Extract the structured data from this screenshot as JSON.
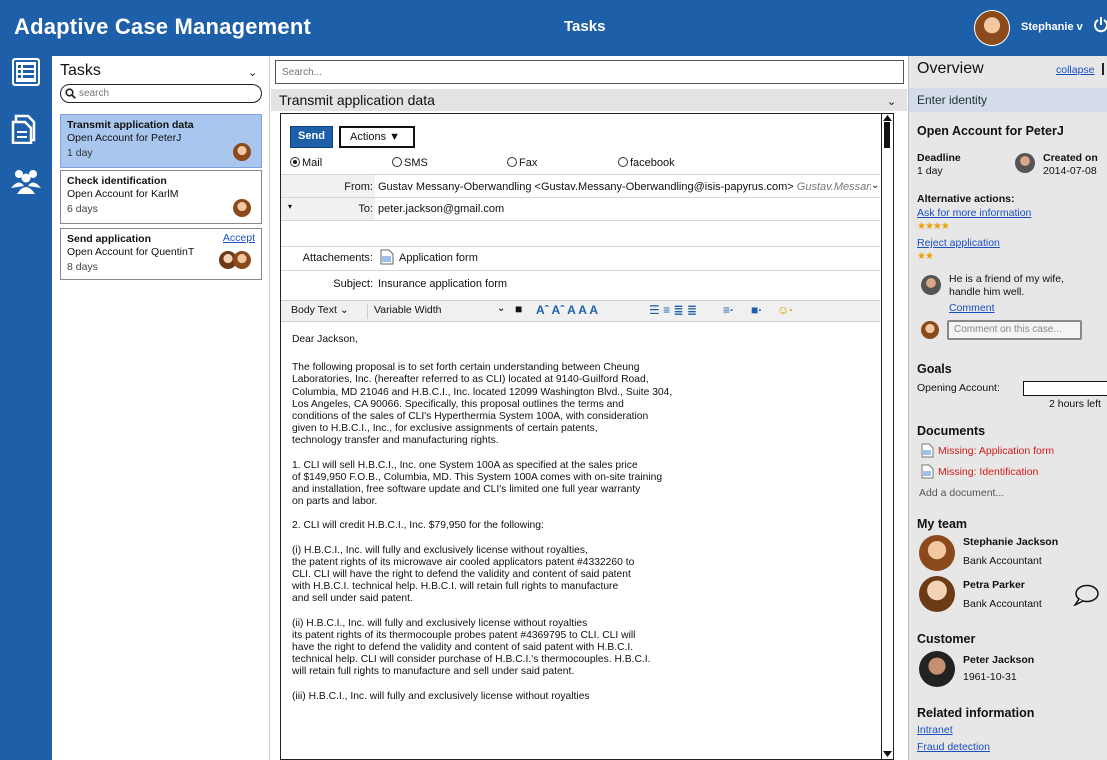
{
  "header": {
    "app_title": "Adaptive Case Management",
    "center_title": "Tasks",
    "user_name": "Stephanie v"
  },
  "rail": {
    "icons": [
      "task-list-icon",
      "documents-icon",
      "team-icon"
    ]
  },
  "tasks": {
    "title": "Tasks",
    "search_placeholder": "search",
    "items": [
      {
        "title": "Transmit application data",
        "subtitle": "Open Account for PeterJ",
        "age": "1 day"
      },
      {
        "title": "Check identification",
        "subtitle": "Open Account for KarlM",
        "age": "6 days"
      },
      {
        "title": "Send application",
        "subtitle": "Open Account for QuentinT",
        "age": "8 days",
        "action": "Accept"
      }
    ]
  },
  "main": {
    "search_placeholder": "Search...",
    "section_title": "Transmit application data",
    "send_label": "Send",
    "actions_label": "Actions",
    "channels": [
      {
        "label": "Mail",
        "selected": true
      },
      {
        "label": "SMS",
        "selected": false
      },
      {
        "label": "Fax",
        "selected": false
      },
      {
        "label": "facebook",
        "selected": false
      }
    ],
    "from_label": "From:",
    "from_value": "Gustav Messany-Oberwandling <Gustav.Messany-Oberwandling@isis-papyrus.com>",
    "from_secondary": "Gustav.Messany-...",
    "to_label": "To:",
    "to_value": "peter.jackson@gmail.com",
    "attachments_label": "Attachements:",
    "attachment": "Application form",
    "subject_label": "Subject:",
    "subject_value": "Insurance application form",
    "toolbar": {
      "style_select": "Body Text",
      "font_select": "Variable Width",
      "format_glyphs": "Aˆ Aˆ A A A",
      "list_glyphs": "☰ ≡ ≣ ≣",
      "align_glyph": "≡·",
      "emoji_glyph": "☺·"
    },
    "body": [
      "Dear Jackson,",
      "The following  proposal is to set forth  certain  understanding  between  Cheung\nLaboratories, Inc. (hereafter referred to as CLI) located at 9140-Guilford Road,\nColumbia, MD 21046 and H.B.C.I., Inc. located 12099 Washington Blvd., Suite 304,\nLos  Angeles,  CA 90066.  Specifically,  this proposal  outlines  the  terms and\nconditions of the sales of CLI's  Hyperthermia  System 100A, with  consideration\ngiven  to H.B.C.I.,  Inc.,  for exclusive  assignments  of  certain  patents,\ntechnology transfer and manufacturing rights.",
      "1. CLI will sell H.B.C.I.,  Inc. one System 100A as specified at the sales price\nof $149,950 F.O.B.,  Columbia,  MD. This System 100A comes with on-site training\nand installation,  free software update and CLI's limited one full year warranty\non parts and labor.",
      "2.      CLI will credit H.B.C.I., Inc. $79,950 for the following:",
      "    (i) H.B.C.I.,  Inc. will fully and exclusively  license without  royalties,\nthe patent  rights of its microwave air cooled  applicators  patent  #4332260 to\nCLI.  CLI will have the right to defend the  validity  and content of said patent\nwith H.B.C.I.  technical help.  H.B.C.I.  will retain full rights to manufacture\nand sell under said patent.",
      "    (ii) H.B.C.I.,  Inc. will fully and exclusively  license without  royalties\nits patent rights of its  thermocouple  probes patent  #4369795 to CLI. CLI will\nhave the right to defend the validity  and content of said patent with  H.B.C.I.\ntechnical help. CLI will consider purchase of H.B.C.I.'s thermocouples. H.B.C.I.\nwill retain full rights to manufacture and sell under said patent.",
      "    (iii) H.B.C.I.,  Inc. will fully and exclusively  license without  royalties"
    ]
  },
  "overview": {
    "title": "Overview",
    "collapse_label": "collapse",
    "identity_bar": "Enter identity",
    "case_title": "Open Account for PeterJ",
    "deadline_label": "Deadline",
    "deadline_value": "1 day",
    "created_label": "Created on",
    "created_value": "2014-07-08",
    "alt_actions_label": "Alternative actions:",
    "alt_actions": [
      {
        "label": "Ask for more information",
        "stars": "★★★★"
      },
      {
        "label": "Reject application",
        "stars": "★★"
      }
    ],
    "comment_text": "He is a friend of my wife,\nhandle him well.",
    "comment_link": "Comment",
    "comment_placeholder": "Comment on this case...",
    "goals_label": "Goals",
    "goal_name": "Opening Account:",
    "goal_progress": 0.0,
    "goal_time_left": "2 hours left",
    "documents_label": "Documents",
    "documents": [
      "Missing: Application form",
      "Missing: Identification"
    ],
    "add_document": "Add a document...",
    "team_label": "My team",
    "team": [
      {
        "name": "Stephanie Jackson",
        "role": "Bank Accountant"
      },
      {
        "name": "Petra Parker",
        "role": "Bank Accountant"
      }
    ],
    "customer_label": "Customer",
    "customer_name": "Peter Jackson",
    "customer_dob": "1961-10-31",
    "related_label": "Related information",
    "related_links": [
      "Intranet",
      "Fraud detection"
    ]
  }
}
